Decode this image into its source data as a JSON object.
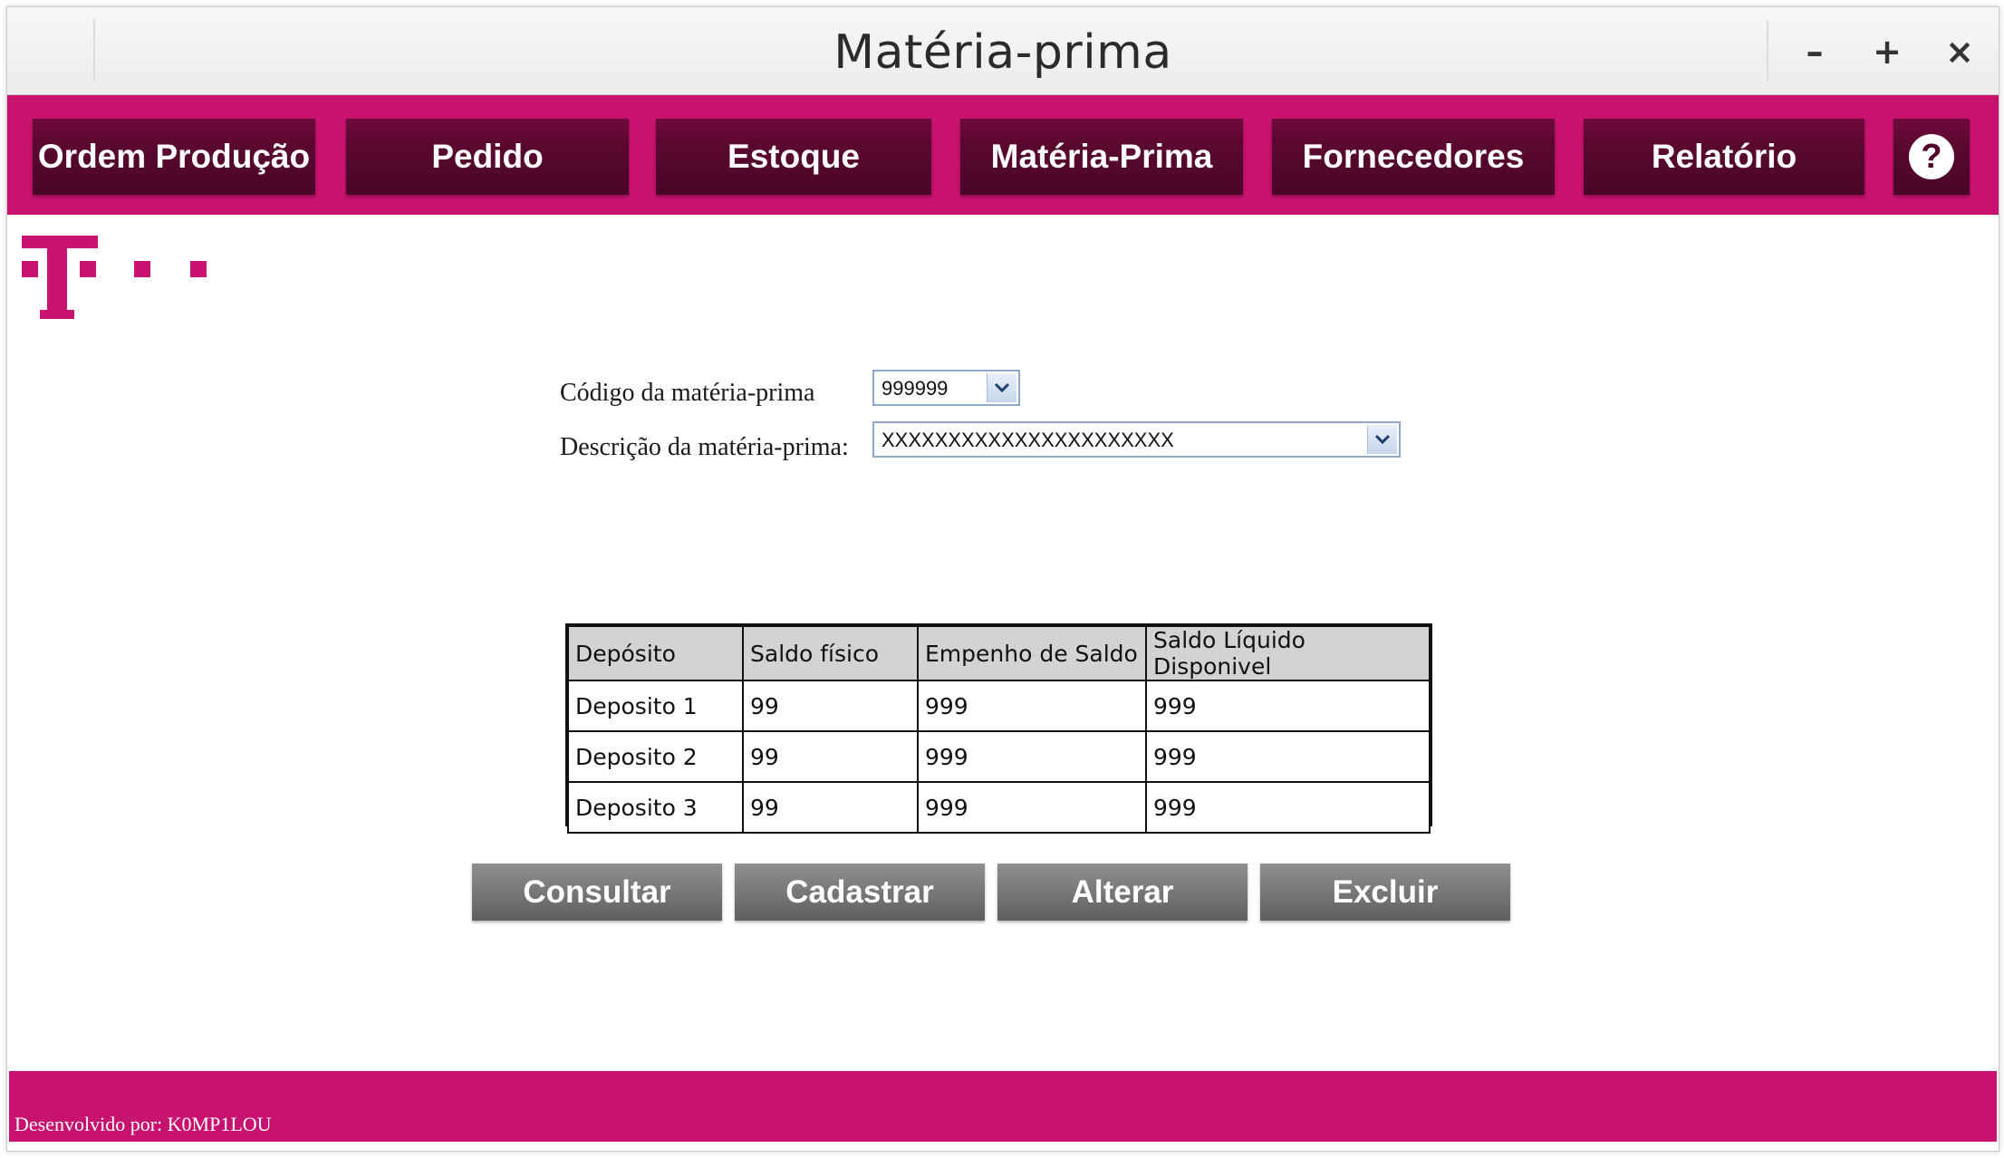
{
  "window": {
    "title": "Matéria-prima",
    "controls": {
      "minimize": "–",
      "maximize": "+",
      "close": "×"
    }
  },
  "nav": {
    "items": [
      {
        "label": "Ordem Produção"
      },
      {
        "label": "Pedido"
      },
      {
        "label": "Estoque"
      },
      {
        "label": "Matéria-Prima"
      },
      {
        "label": "Fornecedores"
      },
      {
        "label": "Relatório"
      }
    ],
    "help_label": "?"
  },
  "form": {
    "code_label": "Código da matéria-prima",
    "code_value": "999999",
    "description_label": "Descrição da matéria-prima:",
    "description_value": "XXXXXXXXXXXXXXXXXXXXXX"
  },
  "table": {
    "headers": [
      "Depósito",
      "Saldo físico",
      "Empenho de Saldo",
      "Saldo Líquido Disponivel"
    ],
    "rows": [
      [
        "Deposito 1",
        "99",
        "999",
        "999"
      ],
      [
        "Deposito 2",
        "99",
        "999",
        "999"
      ],
      [
        "Deposito 3",
        "99",
        "999",
        "999"
      ]
    ]
  },
  "actions": {
    "consultar": "Consultar",
    "cadastrar": "Cadastrar",
    "alterar": "Alterar",
    "excluir": "Excluir"
  },
  "footer": {
    "text": "Desenvolvido por: K0MP1LOU"
  },
  "colors": {
    "brand_magenta": "#c8126f",
    "nav_button": "#5a082f",
    "action_button": "#7a7a7a",
    "table_header": "#d3d3d3"
  },
  "icons": {
    "logo": "telekom-t-logo",
    "help": "question-mark-icon",
    "dropdown": "chevron-down-icon"
  }
}
